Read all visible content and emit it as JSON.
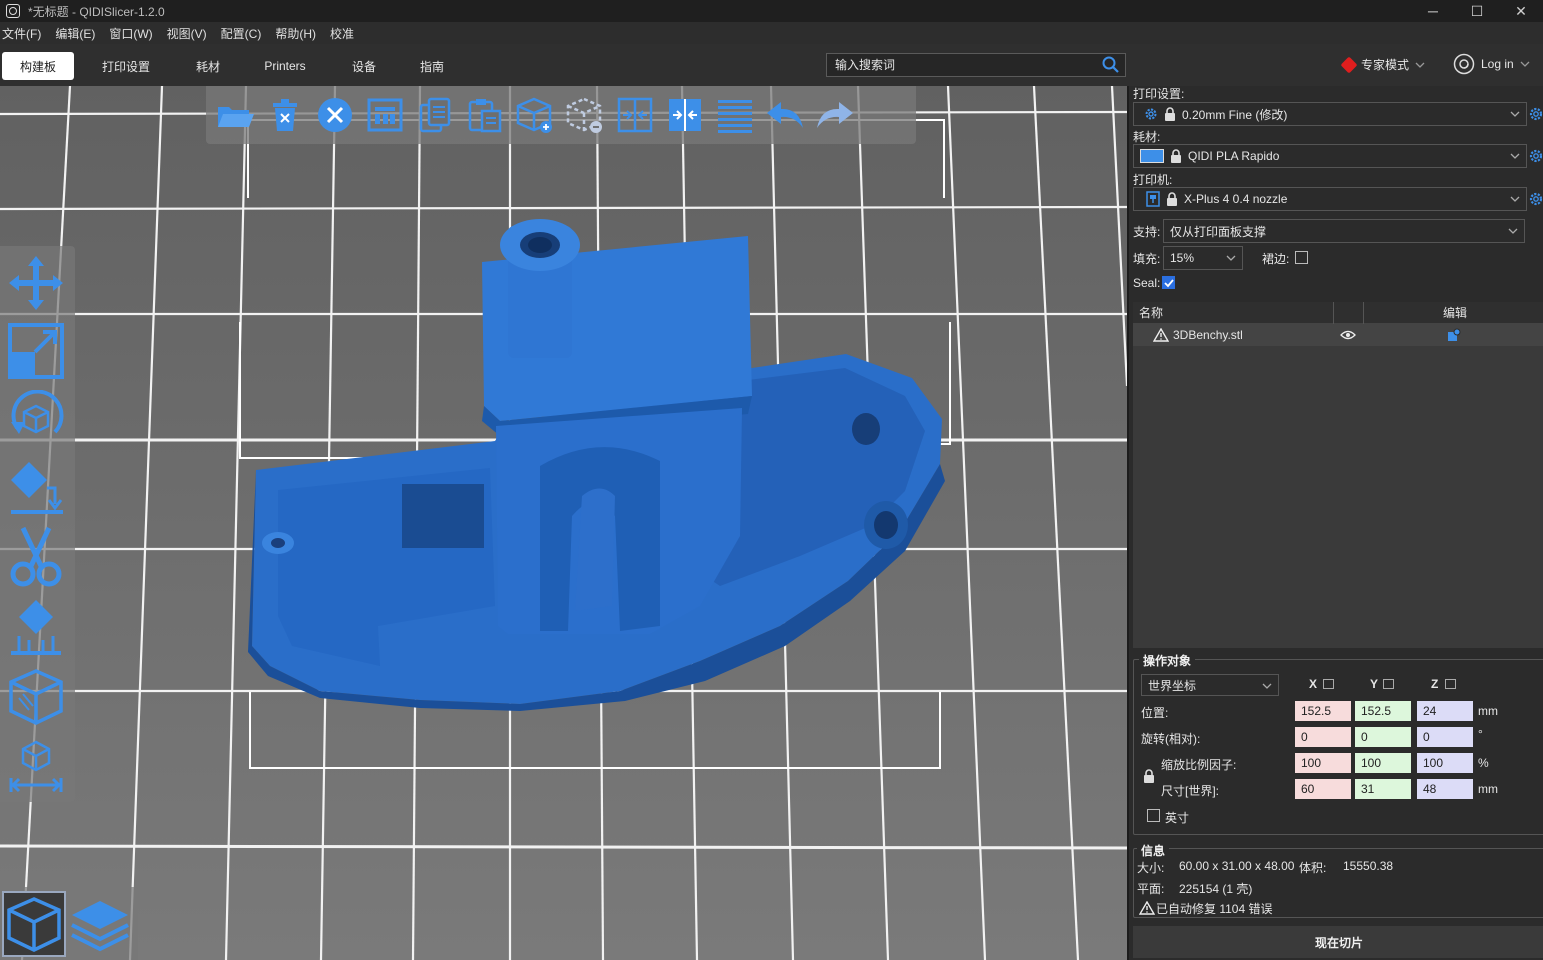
{
  "window": {
    "title": "*无标题 - QIDISlicer-1.2.0",
    "minimize": "─",
    "maximize": "☐",
    "close": "✕"
  },
  "menu": [
    "文件(F)",
    "编辑(E)",
    "窗口(W)",
    "视图(V)",
    "配置(C)",
    "帮助(H)",
    "校准"
  ],
  "tabs": [
    "构建板",
    "打印设置",
    "耗材",
    "Printers",
    "设备",
    "指南"
  ],
  "search": {
    "placeholder": "输入搜索词"
  },
  "mode": {
    "label": "专家模式",
    "color": "#e01e1e"
  },
  "login": {
    "label": "Log in"
  },
  "top_toolbar_icons": [
    "open-folder-icon",
    "delete-icon",
    "delete-all-icon",
    "arrange-icon",
    "copy-icon",
    "paste-icon",
    "add-instance-icon",
    "remove-instance-icon",
    "split-objects-icon",
    "split-parts-icon",
    "layers-editing-icon",
    "undo-icon",
    "redo-icon"
  ],
  "left_toolbar_icons": [
    "move-icon",
    "scale-icon",
    "rotate-icon",
    "place-on-face-icon",
    "cut-icon",
    "supports-paint-icon",
    "seam-paint-icon",
    "measure-icon"
  ],
  "view_switch_icons": [
    "3d-view-icon",
    "preview-layers-icon"
  ],
  "panel": {
    "print_settings_label": "打印设置:",
    "print_settings_value": "0.20mm Fine (修改)",
    "filament_label": "耗材:",
    "filament_value": "QIDI PLA Rapido",
    "filament_color": "#3d8fe8",
    "printer_label": "打印机:",
    "printer_value": "X-Plus 4 0.4 nozzle",
    "support_label": "支持:",
    "support_value": "仅从打印面板支撑",
    "infill_label": "填充:",
    "infill_value": "15%",
    "brim_label": "裙边:",
    "seal_label": "Seal:"
  },
  "object_list": {
    "col_name": "名称",
    "col_edit": "编辑",
    "rows": [
      {
        "name": "3DBenchy.stl"
      }
    ]
  },
  "manipulation": {
    "title": "操作对象",
    "coord_system": "世界坐标",
    "axis_x": "X",
    "axis_y": "Y",
    "axis_z": "Z",
    "position_label": "位置:",
    "position": [
      "152.5",
      "152.5",
      "24"
    ],
    "position_unit": "mm",
    "rotation_label": "旋转(相对):",
    "rotation": [
      "0",
      "0",
      "0"
    ],
    "rotation_unit": "°",
    "scale_label": "缩放比例因子:",
    "scale": [
      "100",
      "100",
      "100"
    ],
    "scale_unit": "%",
    "size_label": "尺寸[世界]:",
    "size": [
      "60",
      "31",
      "48"
    ],
    "size_unit": "mm",
    "inches_label": "英寸"
  },
  "info": {
    "title": "信息",
    "size_label": "大小:",
    "size_value": "60.00 x 31.00 x 48.00",
    "volume_label": "体积:",
    "volume_value": "15550.38",
    "facets_label": "平面:",
    "facets_value": "225154 (1 壳)",
    "repair_text": "已自动修复 1104 错误"
  },
  "slice_button": "现在切片",
  "colors": {
    "accent": "#2b6fe0",
    "model": "#2e74d2",
    "icon_blue": "#3d8fe8"
  }
}
